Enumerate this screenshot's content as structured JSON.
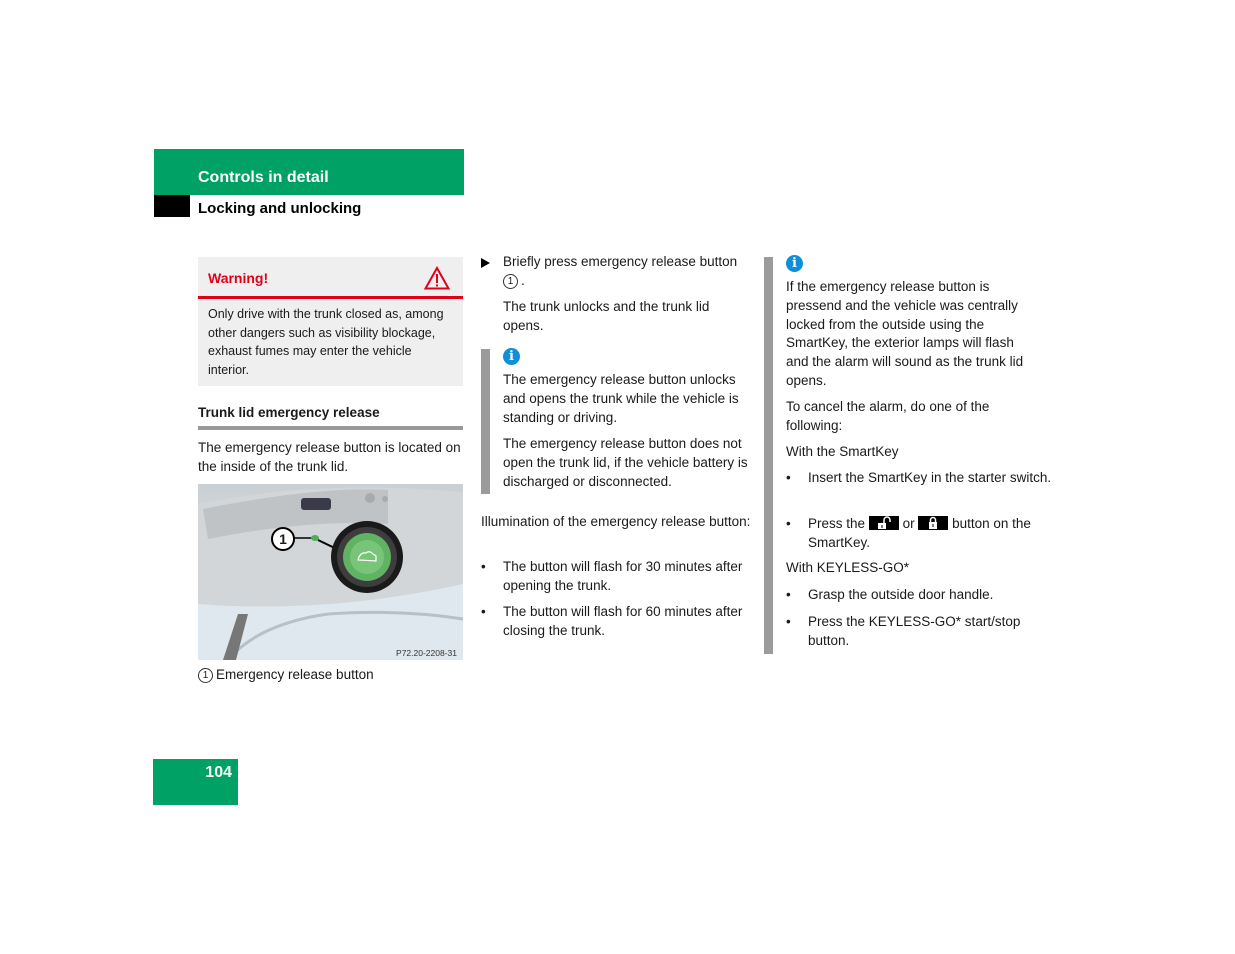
{
  "header": {
    "section": "Controls in detail",
    "subsection": "Locking and unlocking"
  },
  "warning": {
    "title": "Warning!",
    "icon": "warning-triangle-icon",
    "body": "Only drive with the trunk closed as, among other dangers such as visibility blockage, exhaust fumes may enter the vehicle interior."
  },
  "left": {
    "heading": "Trunk lid emergency release",
    "paragraph": "The emergency release button is located on the inside of the trunk lid.",
    "figure": {
      "callout": "1",
      "code": "P72.20-2208-31"
    },
    "caption_num": "1",
    "caption": "Emergency release button"
  },
  "middle": {
    "step": "Briefly press emergency release button",
    "step_ref": "1",
    "step_end": ".",
    "step_result": "The trunk unlocks and the trunk lid opens.",
    "info": {
      "icon": "info-icon",
      "p1": "The emergency release button unlocks and opens the trunk while the vehicle is standing or driving.",
      "p2": "The emergency release button does not open the trunk lid, if the vehicle battery is discharged or disconnected."
    },
    "illumination": "Illumination of the emergency release button:",
    "bullets": [
      "The button will flash for 30 minutes after opening the trunk.",
      "The button will flash for 60 minutes after closing the trunk."
    ]
  },
  "right": {
    "icon": "info-icon",
    "p1": "If the emergency release button is pressend and the vehicle was centrally locked from the outside using the SmartKey, the exterior lamps will flash and the alarm will sound as the trunk lid opens.",
    "p2": "To cancel the alarm, do one of the following:",
    "smartkey_heading": "With the SmartKey",
    "smartkey_bullets": {
      "b1": "Insert the SmartKey in the starter switch.",
      "b2_pre": "Press the",
      "b2_mid": "or",
      "b2_post": "button on the SmartKey."
    },
    "keyless_heading": "With KEYLESS-GO*",
    "keyless_bullets": [
      "Grasp the outside door handle.",
      "Press the KEYLESS-GO* start/stop button."
    ],
    "bullet_char": "•"
  },
  "page_number": "104",
  "colors": {
    "brand_green": "#00a165",
    "warning_red": "#e0001a",
    "info_blue": "#0f8fd8"
  }
}
